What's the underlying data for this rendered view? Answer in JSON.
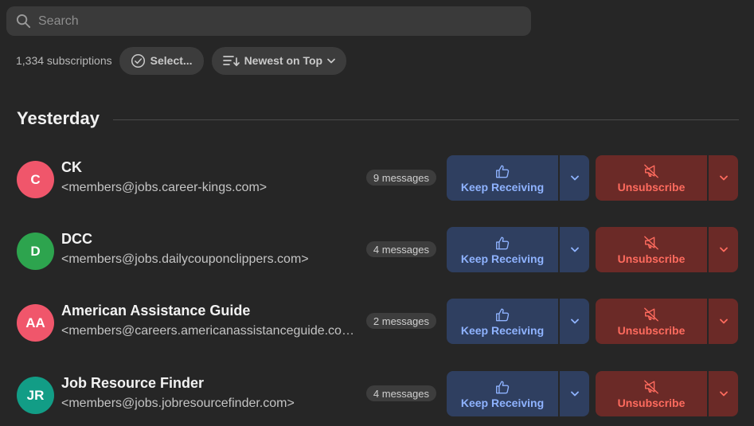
{
  "search": {
    "placeholder": "Search",
    "icon": "search-icon"
  },
  "toolbar": {
    "count": "1,334 subscriptions",
    "select_label": "Select...",
    "sort_label": "Newest on Top"
  },
  "section": {
    "title": "Yesterday"
  },
  "actions": {
    "keep_label": "Keep Receiving",
    "unsubscribe_label": "Unsubscribe"
  },
  "colors": {
    "keep_bg": "#2f3f60",
    "keep_text": "#8fb3ff",
    "unsub_bg": "#6b2a27",
    "unsub_text": "#ff6b5e"
  },
  "subscriptions": [
    {
      "initials": "C",
      "name": "CK",
      "email": "<members@jobs.career-kings.com>",
      "messages": "9 messages",
      "avatar_color": "#f0566b"
    },
    {
      "initials": "D",
      "name": "DCC",
      "email": "<members@jobs.dailycouponclippers.com>",
      "messages": "4 messages",
      "avatar_color": "#2da44e"
    },
    {
      "initials": "AA",
      "name": "American Assistance Guide",
      "email": "<members@careers.americanassistanceguide.com>",
      "messages": "2 messages",
      "avatar_color": "#f0566b"
    },
    {
      "initials": "JR",
      "name": "Job Resource Finder",
      "email": "<members@jobs.jobresourcefinder.com>",
      "messages": "4 messages",
      "avatar_color": "#129d86"
    }
  ]
}
